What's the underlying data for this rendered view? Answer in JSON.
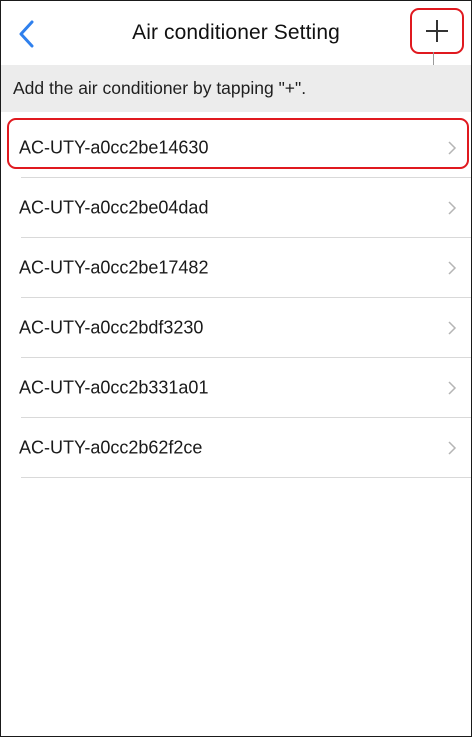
{
  "navbar": {
    "back_icon": "chevron-left-icon",
    "title": "Air conditioner Setting",
    "add_icon": "plus-icon"
  },
  "hint": "Add the air conditioner by tapping \"+\".",
  "devices": [
    {
      "label": "AC-UTY-a0cc2be14630"
    },
    {
      "label": "AC-UTY-a0cc2be04dad"
    },
    {
      "label": "AC-UTY-a0cc2be17482"
    },
    {
      "label": "AC-UTY-a0cc2bdf3230"
    },
    {
      "label": "AC-UTY-a0cc2b331a01"
    },
    {
      "label": "AC-UTY-a0cc2b62f2ce"
    }
  ],
  "colors": {
    "accent": "#2f80ed",
    "highlight": "#e0191f",
    "hint_background": "#ececec",
    "divider": "#d9d9d9",
    "chevron": "#b5b5b5"
  }
}
